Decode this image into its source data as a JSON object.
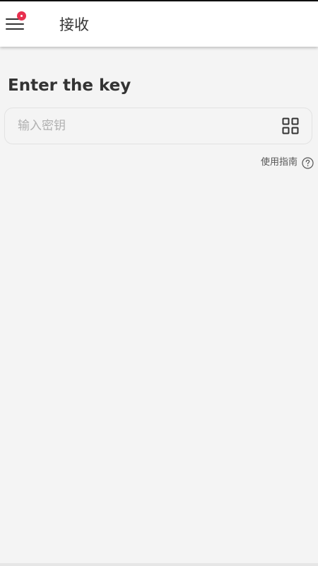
{
  "app_bar": {
    "title": "接收",
    "menu_icon": "hamburger-menu-icon",
    "notification_dot_color": "#e8304f"
  },
  "main": {
    "heading": "Enter the key",
    "key_field": {
      "placeholder": "输入密钥",
      "value": "",
      "scan_icon": "qr-code-icon"
    },
    "help_link": {
      "label": "使用指南",
      "icon": "question-circle-icon"
    }
  },
  "colors": {
    "background": "#f4f4f4",
    "app_bar": "#ffffff",
    "accent": "#e8304f",
    "text_primary": "#333333",
    "placeholder": "#b0b0b0"
  }
}
